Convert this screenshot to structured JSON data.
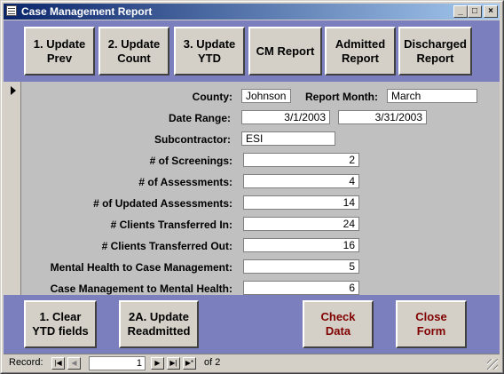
{
  "window": {
    "title": "Case Management Report",
    "controls": {
      "minimize": "_",
      "maximize": "□",
      "close": "×"
    }
  },
  "top_buttons": [
    "1. Update\nPrev",
    "2. Update\nCount",
    "3. Update\nYTD",
    "CM Report",
    "Admitted\nReport",
    "Discharged\nReport"
  ],
  "form": {
    "county": {
      "label": "County:",
      "value": "Johnson"
    },
    "report_month": {
      "label": "Report Month:",
      "value": "March"
    },
    "date_range": {
      "label": "Date Range:",
      "start": "3/1/2003",
      "end": "3/31/2003"
    },
    "subcontractor": {
      "label": "Subcontractor:",
      "value": "ESI"
    },
    "metrics": [
      {
        "label": "# of Screenings:",
        "value": "2"
      },
      {
        "label": "# of Assessments:",
        "value": "4"
      },
      {
        "label": "# of Updated Assessments:",
        "value": "14"
      },
      {
        "label": "# Clients Transferred In:",
        "value": "24"
      },
      {
        "label": "# Clients Transferred Out:",
        "value": "16"
      },
      {
        "label": "Mental Health to Case Management:",
        "value": "5"
      },
      {
        "label": "Case Management to Mental Health:",
        "value": "6"
      }
    ]
  },
  "bottom_buttons": {
    "clear_ytd": "1.  Clear\nYTD fields",
    "update_readmitted": "2A.  Update\nReadmitted",
    "check_data": "Check\nData",
    "close_form": "Close\nForm"
  },
  "record_nav": {
    "label": "Record:",
    "current": "1",
    "of_text": "of  2",
    "first_icon": "|◀",
    "prev_icon": "◀",
    "next_icon": "▶",
    "last_icon": "▶|",
    "new_icon": "▶*"
  },
  "colors": {
    "title_bar_start": "#0a246a",
    "title_bar_end": "#a6caf0",
    "band": "#7b7fbd",
    "detail_bg": "#c0c0c0",
    "accent_text": "#800000"
  }
}
